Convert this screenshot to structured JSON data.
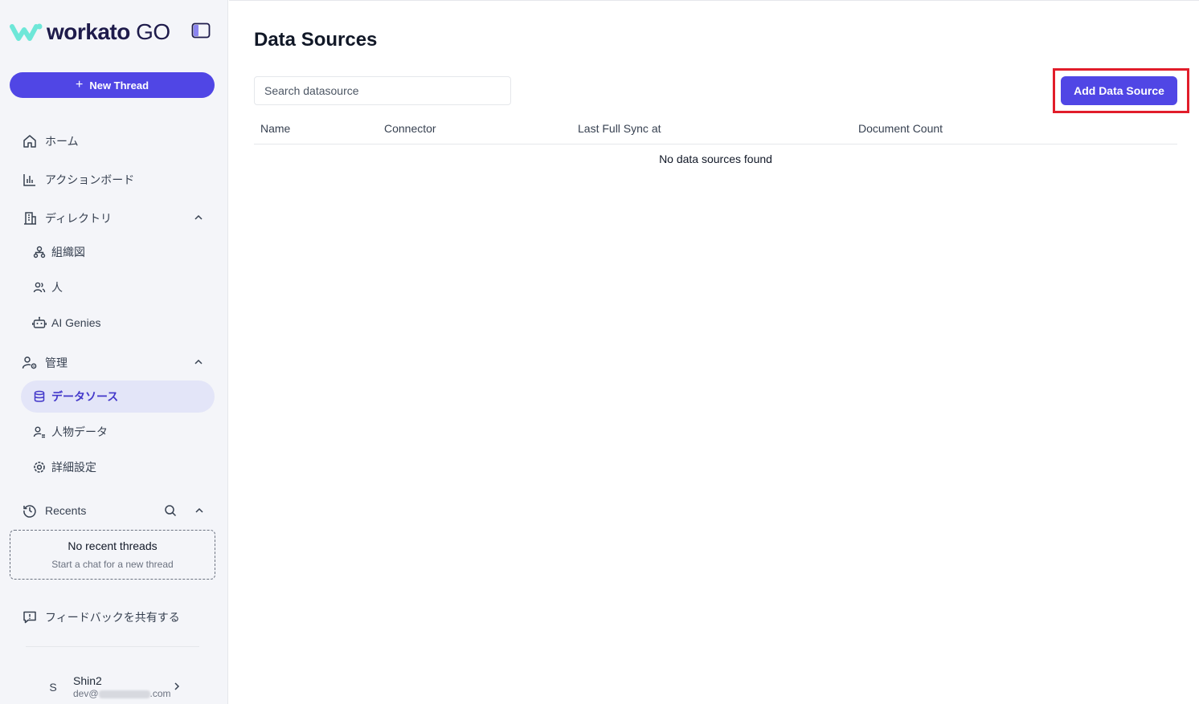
{
  "brand": {
    "name": "workato",
    "suffix": "GO"
  },
  "sidebar": {
    "new_thread_label": "New Thread",
    "nav": {
      "home": "ホーム",
      "action_board": "アクションボード",
      "directory": "ディレクトリ",
      "org_chart": "組織図",
      "people": "人",
      "ai_genies": "AI Genies",
      "admin": "管理",
      "data_sources": "データソース",
      "people_data": "人物データ",
      "advanced_settings": "詳細設定"
    },
    "recents": {
      "label": "Recents",
      "empty_title": "No recent threads",
      "empty_subtitle": "Start a chat for a new thread"
    },
    "feedback_label": "フィードバックを共有する",
    "user": {
      "initial": "S",
      "name": "Shin2",
      "email_prefix": "dev@",
      "email_suffix": ".com"
    }
  },
  "main": {
    "title": "Data Sources",
    "search_placeholder": "Search datasource",
    "add_button_label": "Add Data Source",
    "columns": [
      "Name",
      "Connector",
      "Last Full Sync at",
      "Document Count"
    ],
    "empty_message": "No data sources found"
  },
  "colors": {
    "accent": "#5046e5",
    "highlight_box": "#e11d2a",
    "sidebar_bg": "#f4f5f9",
    "active_item_bg": "#e3e5f8",
    "logo_mark": "#6ee7d8"
  }
}
